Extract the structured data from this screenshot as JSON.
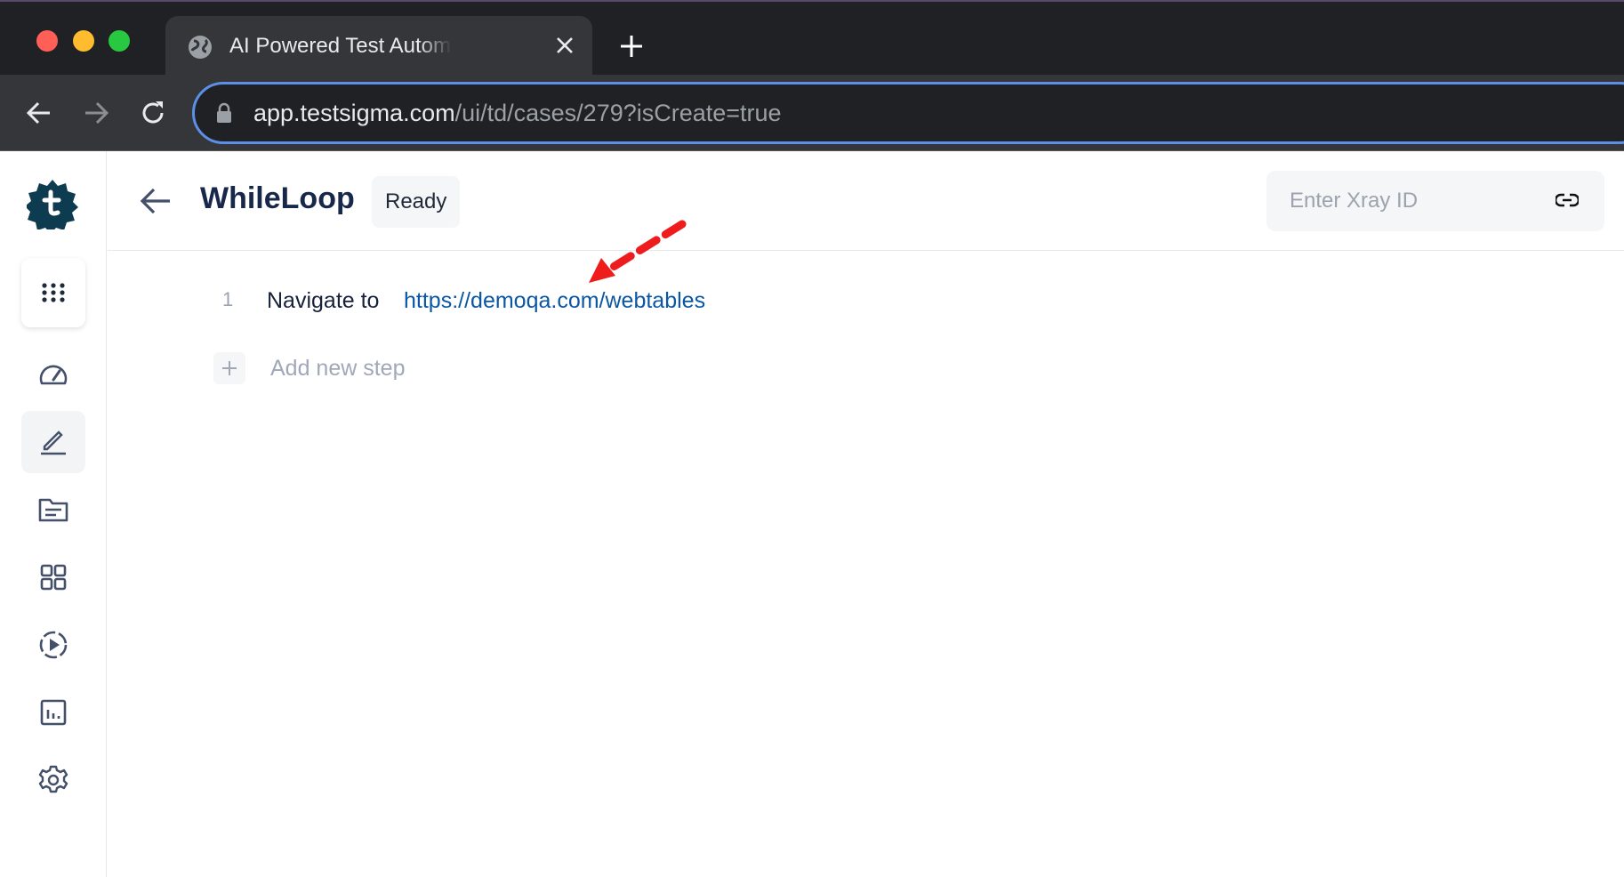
{
  "browser": {
    "tab_title": "AI Powered Test Automation Platform",
    "url_host": "app.testsigma.com",
    "url_path": "/ui/td/cases/279?isCreate=true",
    "colors": {
      "close": "#ff5f57",
      "minimize": "#febc2e",
      "zoom": "#28c840",
      "focus_ring": "#5c8fe6"
    }
  },
  "sidebar": {
    "items": [
      {
        "icon": "apps-grid-icon"
      },
      {
        "icon": "dashboard-gauge-icon"
      },
      {
        "icon": "test-development-pencil-icon",
        "active": true
      },
      {
        "icon": "folder-icon"
      },
      {
        "icon": "modules-grid-icon"
      },
      {
        "icon": "run-play-icon"
      },
      {
        "icon": "reports-chart-icon"
      },
      {
        "icon": "settings-gear-icon"
      }
    ],
    "brand_color": "#0d3b4f"
  },
  "header": {
    "title": "WhileLoop",
    "status": "Ready",
    "xray_placeholder": "Enter Xray ID",
    "xray_value": ""
  },
  "steps": [
    {
      "number": "1",
      "action": "Navigate to",
      "target": "https://demoqa.com/webtables"
    }
  ],
  "add_step_label": "Add new step",
  "annotation": {
    "type": "red dashed arrow pointing to step URL",
    "color": "#ee1c1c"
  }
}
